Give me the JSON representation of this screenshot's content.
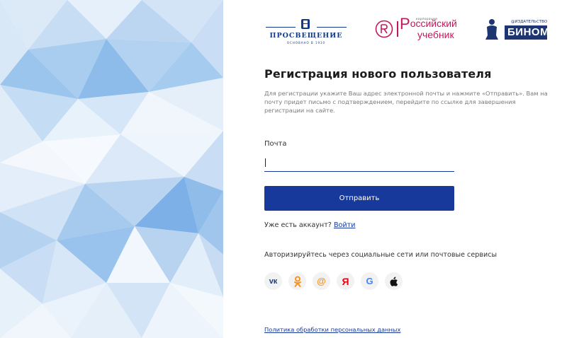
{
  "logos": {
    "prosveshchenie": {
      "name": "ПРОСВЕЩЕНИЕ",
      "subtitle": "ОСНОВАНО В 1930"
    },
    "rossiyskiy_uchebnik": {
      "tag": "корпорация",
      "line1_initial": "Р",
      "line1_rest": "оссийский",
      "line2": "учебник"
    },
    "binom": {
      "tag": "@ИЗДАТЕЛЬСТВО",
      "name": "БИНОМ"
    }
  },
  "form": {
    "title": "Регистрация нового пользователя",
    "description": "Для регистрации укажите Ваш адрес электронной почты и нажмите «Отправить». Вам на почту придет письмо с подтверждением, перейдите по ссылке для завершения регистрации на сайте.",
    "email_label": "Почта",
    "email_value": "",
    "submit_label": "Отправить",
    "have_account_text": "Уже есть аккаунт?",
    "login_link": "Войти",
    "social_label": "Авторизируйтесь через социальные сети или почтовые сервисы",
    "socials": [
      {
        "icon": "vk-icon",
        "glyph": "vк"
      },
      {
        "icon": "odnoklassniki-icon",
        "glyph": "ok"
      },
      {
        "icon": "mail-ru-icon",
        "glyph": "@"
      },
      {
        "icon": "yandex-icon",
        "glyph": "Я"
      },
      {
        "icon": "google-icon",
        "glyph": "G"
      },
      {
        "icon": "apple-icon",
        "glyph": ""
      }
    ],
    "policy_link": "Политика обработки персональных данных"
  },
  "colors": {
    "primary": "#17399b",
    "text": "#1c1c1c",
    "muted": "#7a7a7a",
    "accent_pink": "#c2185b",
    "binom_blue": "#1d3570"
  }
}
